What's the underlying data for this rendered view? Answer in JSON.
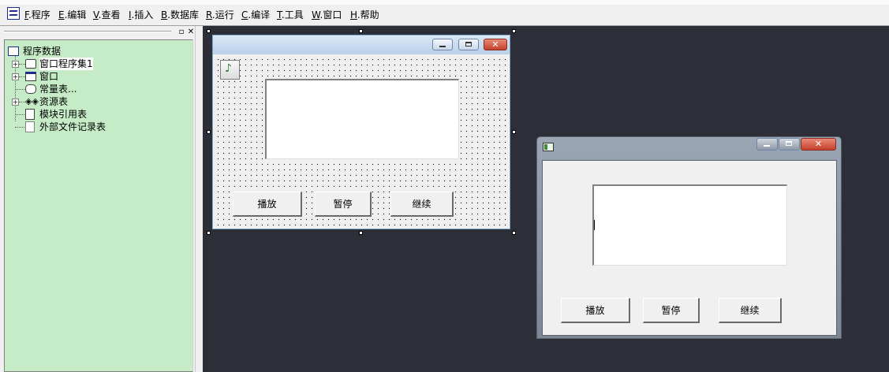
{
  "menu": [
    {
      "key": "F",
      "label": ".程序"
    },
    {
      "key": "E",
      "label": ".编辑"
    },
    {
      "key": "V",
      "label": ".查看"
    },
    {
      "key": "I",
      "label": ".插入"
    },
    {
      "key": "B",
      "label": ".数据库"
    },
    {
      "key": "R",
      "label": ".运行"
    },
    {
      "key": "C",
      "label": ".编译"
    },
    {
      "key": "T",
      "label": ".工具"
    },
    {
      "key": "W",
      "label": ".窗口"
    },
    {
      "key": "H",
      "label": ".帮助"
    }
  ],
  "panel": {
    "pin_glyph": "▫",
    "close_glyph": "✕",
    "tree": {
      "root": "程序数据",
      "items": [
        {
          "label": "窗口程序集1",
          "icon": "assembly-icon",
          "expandable": true
        },
        {
          "label": "窗口",
          "icon": "window-icon",
          "expandable": true
        },
        {
          "label": "常量表...",
          "icon": "constant-table-icon",
          "expandable": false
        },
        {
          "label": "资源表",
          "icon": "resource-icon",
          "expandable": true
        },
        {
          "label": "模块引用表",
          "icon": "module-icon",
          "expandable": false
        },
        {
          "label": "外部文件记录表",
          "icon": "file-record-icon",
          "expandable": false
        }
      ]
    }
  },
  "design_window": {
    "buttons": [
      "播放",
      "暂停",
      "继续"
    ]
  },
  "run_window": {
    "buttons": [
      "播放",
      "暂停",
      "继续"
    ]
  },
  "colors": {
    "tree_bg": "#c6ebc7",
    "workspace_bg": "#2c2f37",
    "close_button": "#c4412b"
  }
}
